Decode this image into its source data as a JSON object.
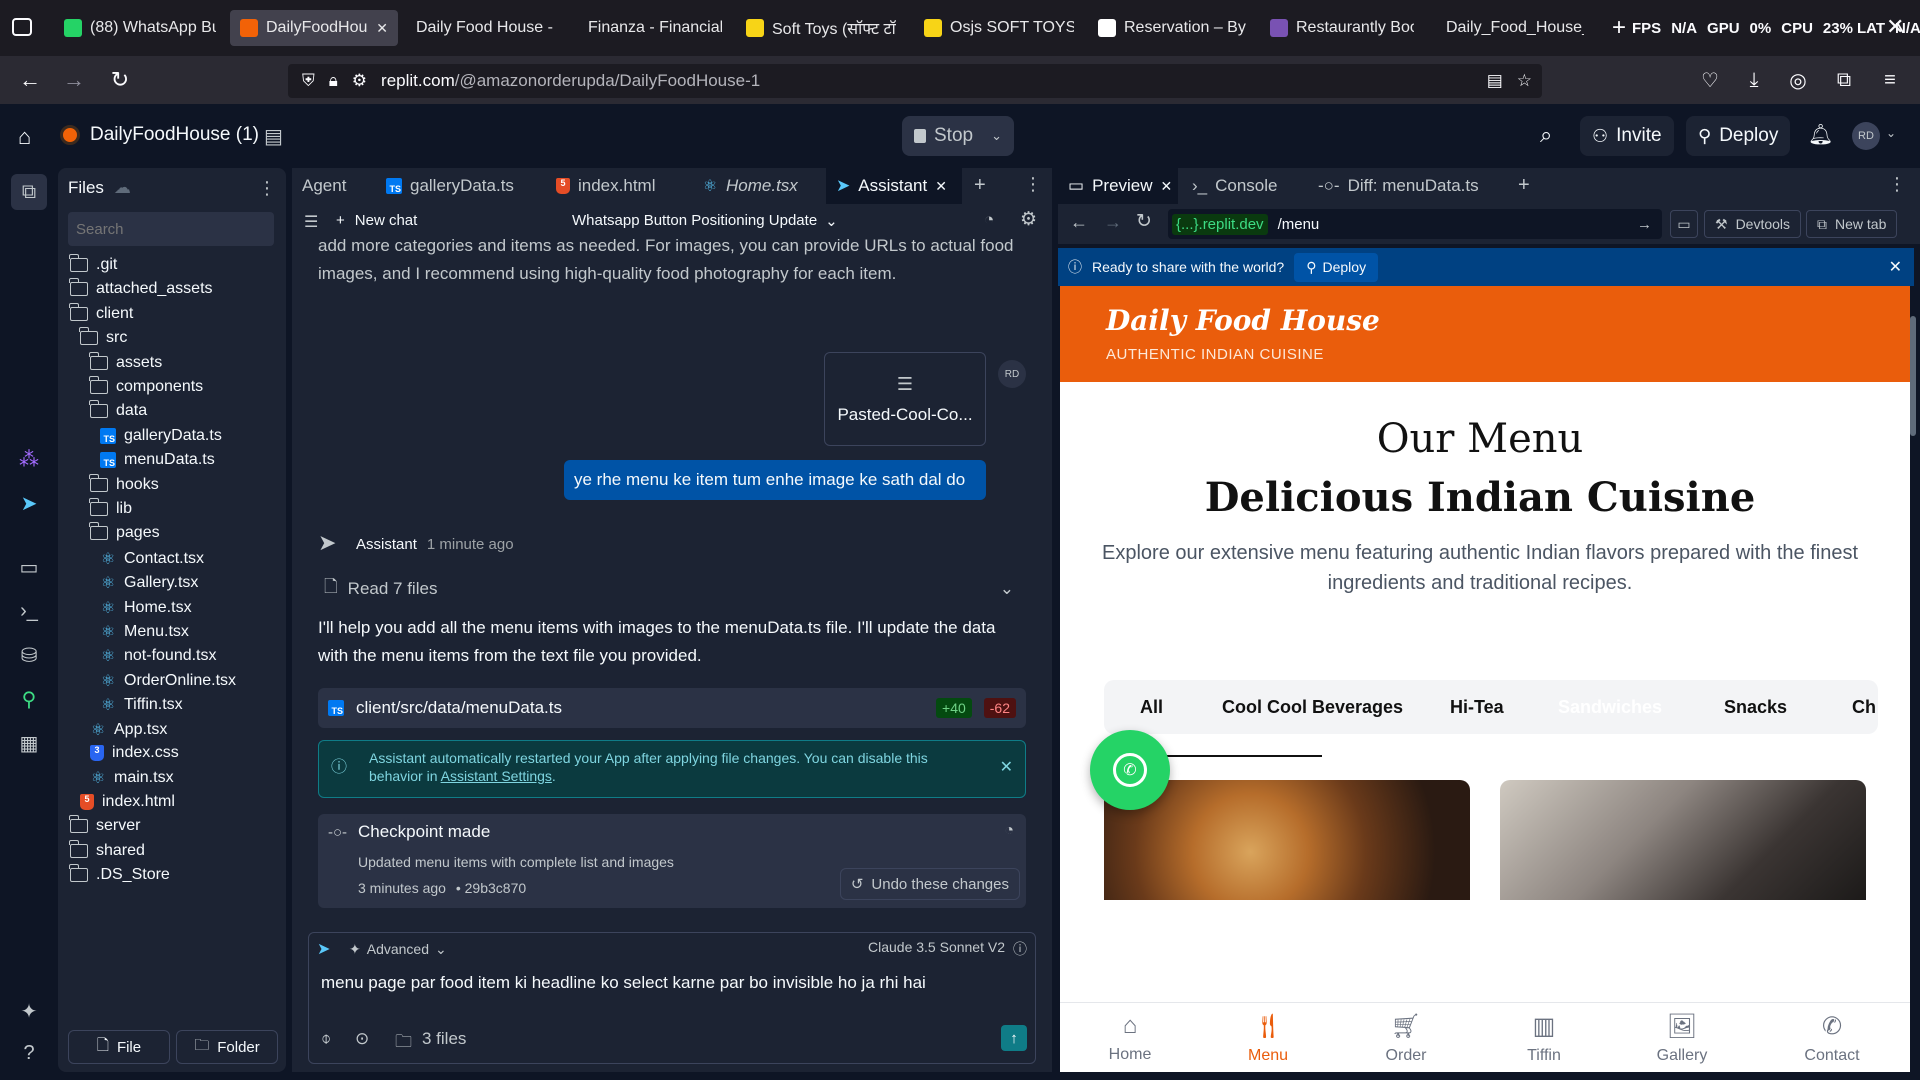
{
  "browser": {
    "tabs": [
      {
        "label": "(88) WhatsApp Bu",
        "icon": "whatsapp-icon",
        "color": "#25d366"
      },
      {
        "label": "DailyFoodHouse",
        "icon": "replit-icon",
        "color": "#f26207",
        "active": true
      },
      {
        "label": "Daily Food House - Be",
        "icon": "page-icon",
        "color": ""
      },
      {
        "label": "Finanza - Financial Ser",
        "icon": "page-icon",
        "color": ""
      },
      {
        "label": "Soft Toys (सॉफ्ट टॉ",
        "icon": "flipkart-icon",
        "color": "#f7d417"
      },
      {
        "label": "Osjs SOFT TOYS L",
        "icon": "flipkart-icon",
        "color": "#f7d417"
      },
      {
        "label": "Reservation – Byb",
        "icon": "wordpress-icon",
        "color": "#ffffff"
      },
      {
        "label": "Restaurantly Boot",
        "icon": "bootstrap-icon",
        "color": "#7952b3"
      },
      {
        "label": "Daily_Food_House_Me",
        "icon": "page-icon",
        "color": ""
      }
    ],
    "perf": {
      "fps_label": "FPS",
      "fps_value": "N/A",
      "gpu_label": "GPU",
      "gpu_value": "0%",
      "cpu_label": "CPU",
      "cpu_value": "23%",
      "lat_label": "LAT",
      "lat_value": "N/A"
    },
    "url": {
      "host": "replit.com",
      "path": "/@amazonorderupda/DailyFoodHouse-1"
    }
  },
  "header": {
    "project": "DailyFoodHouse (1)",
    "stop": "Stop",
    "invite": "Invite",
    "deploy": "Deploy",
    "avatar": "RD"
  },
  "files": {
    "title": "Files",
    "search_placeholder": "Search",
    "items": [
      {
        "name": ".git",
        "type": "folder",
        "level": 0
      },
      {
        "name": "attached_assets",
        "type": "folder",
        "level": 0
      },
      {
        "name": "client",
        "type": "folder",
        "level": 0
      },
      {
        "name": "src",
        "type": "folder",
        "level": 1
      },
      {
        "name": "assets",
        "type": "folder",
        "level": 2
      },
      {
        "name": "components",
        "type": "folder",
        "level": 2
      },
      {
        "name": "data",
        "type": "folder",
        "level": 2
      },
      {
        "name": "galleryData.ts",
        "type": "ts",
        "level": 3
      },
      {
        "name": "menuData.ts",
        "type": "ts",
        "level": 3
      },
      {
        "name": "hooks",
        "type": "folder",
        "level": 2
      },
      {
        "name": "lib",
        "type": "folder",
        "level": 2
      },
      {
        "name": "pages",
        "type": "folder",
        "level": 2
      },
      {
        "name": "Contact.tsx",
        "type": "react",
        "level": 3
      },
      {
        "name": "Gallery.tsx",
        "type": "react",
        "level": 3
      },
      {
        "name": "Home.tsx",
        "type": "react",
        "level": 3
      },
      {
        "name": "Menu.tsx",
        "type": "react",
        "level": 3
      },
      {
        "name": "not-found.tsx",
        "type": "react",
        "level": 3
      },
      {
        "name": "OrderOnline.tsx",
        "type": "react",
        "level": 3
      },
      {
        "name": "Tiffin.tsx",
        "type": "react",
        "level": 3
      },
      {
        "name": "App.tsx",
        "type": "react",
        "level": 2
      },
      {
        "name": "index.css",
        "type": "css",
        "level": 2
      },
      {
        "name": "main.tsx",
        "type": "react",
        "level": 2
      },
      {
        "name": "index.html",
        "type": "html",
        "level": 1
      },
      {
        "name": "server",
        "type": "folder",
        "level": 0
      },
      {
        "name": "shared",
        "type": "folder",
        "level": 0
      },
      {
        "name": ".DS_Store",
        "type": "file",
        "level": 0
      }
    ],
    "new_file": "File",
    "new_folder": "Folder"
  },
  "editor": {
    "tabs": [
      "Agent",
      "galleryData.ts",
      "index.html",
      "Home.tsx",
      "Assistant"
    ],
    "new_chat": "New chat",
    "chat_title": "Whatsapp Button Positioning Update",
    "prev_text": "add more categories and items as needed. For images, you can provide URLs to actual food images, and I recommend using high-quality food photography for each item.",
    "attachment": "Pasted-Cool-Co...",
    "user_avatar": "RD",
    "user_message": "ye rhe menu ke item tum enhe image ke sath dal do",
    "assistant_name": "Assistant",
    "assistant_time": "1 minute ago",
    "read_files": "Read 7 files",
    "reply": "I'll help you add all the menu items with images to the menuData.ts file. I'll update the data with the menu items from the text file you provided.",
    "file_change": {
      "path": "client/src/data/menuData.ts",
      "added": "+40",
      "removed": "-62"
    },
    "notice_text": "Assistant automatically restarted your App after applying file changes. You can disable this behavior in",
    "notice_link": "Assistant Settings",
    "checkpoint": {
      "title": "Checkpoint made",
      "desc": "Updated menu items with complete list and images",
      "time": "3 minutes ago",
      "hash": "• 29b3c870",
      "undo": "Undo these changes"
    },
    "advanced": "Advanced",
    "model": "Claude 3.5 Sonnet V2",
    "input_text": "menu page par food item ki headline ko select karne par bo invisible ho ja rhi hai",
    "files_count": "3 files"
  },
  "preview": {
    "tabs": [
      "Preview",
      "Console",
      "Diff: menuData.ts"
    ],
    "host": "{...}.replit.dev",
    "path": "/menu",
    "devtools": "Devtools",
    "new_tab": "New tab",
    "banner": "Ready to share with the world?",
    "banner_deploy": "Deploy",
    "site": {
      "brand": "Daily Food House",
      "tagline": "AUTHENTIC INDIAN CUISINE",
      "heading1": "Our Menu",
      "heading2": "Delicious Indian Cuisine",
      "subtitle": "Explore our extensive menu featuring authentic Indian flavors prepared with the finest ingredients and traditional recipes.",
      "categories": [
        "All",
        "Cool Cool Beverages",
        "Hi-Tea",
        "Sandwiches",
        "Snacks",
        "Ch"
      ],
      "nav": [
        "Home",
        "Menu",
        "Order",
        "Tiffin",
        "Gallery",
        "Contact"
      ],
      "accent": "#ea5d0c"
    }
  }
}
